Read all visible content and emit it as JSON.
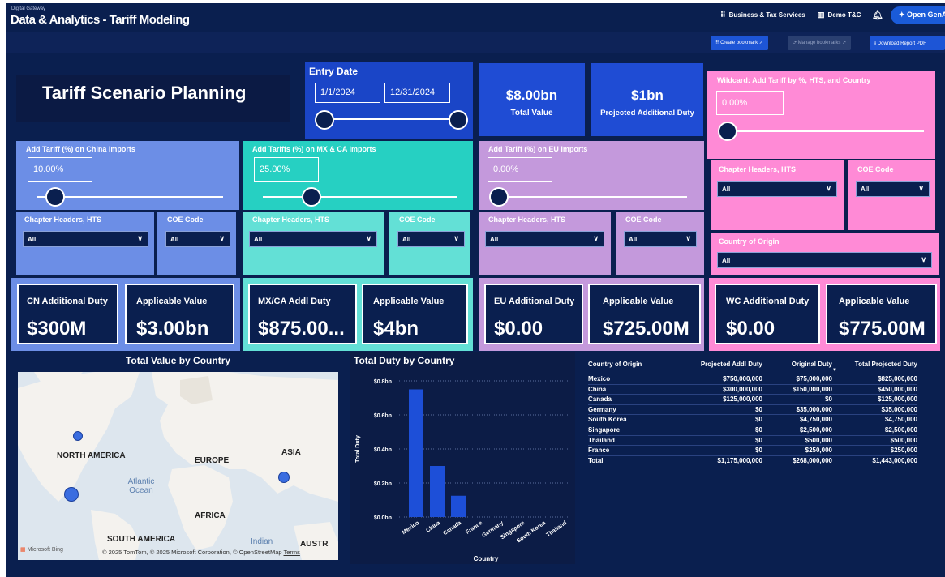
{
  "header": {
    "brand_small": "Digital Gateway",
    "title": "Data & Analytics - Tariff Modeling",
    "nav": [
      {
        "icon": "grid-icon",
        "label": "Business & Tax Services"
      },
      {
        "icon": "workspace-icon",
        "label": "Demo T&C"
      }
    ],
    "genai_label": "Open GenAI"
  },
  "toolbar": {
    "create_bookmark": "Create bookmark",
    "manage_bookmarks": "Manage bookmarks",
    "download_pdf": "Download Report PDF"
  },
  "page_title": "Tariff Scenario Planning",
  "entry_date": {
    "label": "Entry Date",
    "start": "1/1/2024",
    "end": "12/31/2024",
    "range_fraction": [
      0,
      1
    ]
  },
  "totals": {
    "total_value": "$8.00bn",
    "total_value_label": "Total Value",
    "projected_duty": "$1bn",
    "projected_duty_label": "Projected Additional Duty"
  },
  "colors": {
    "china": "#6c8ee6",
    "mxca": "#26d0c2",
    "eu": "#c499dc",
    "wildcard": "#ff8ad6",
    "bar": "#1d4fd8",
    "background": "#0a1f4f"
  },
  "china_panel": {
    "tariff_label": "Add Tariff (%) on China Imports",
    "tariff_value": "10.00%",
    "slider_fraction": 0.1,
    "chapter_label": "Chapter Headers, HTS",
    "chapter_value": "All",
    "coe_label": "COE Code",
    "coe_value": "All",
    "kpi_duty_label": "CN Additional Duty",
    "kpi_duty_value": "$300M",
    "kpi_value_label": "Applicable Value",
    "kpi_value_value": "$3.00bn"
  },
  "mxca_panel": {
    "tariff_label": "Add Tariffs (%) on MX & CA Imports",
    "tariff_value": "25.00%",
    "slider_fraction": 0.25,
    "chapter_label": "Chapter Headers, HTS",
    "chapter_value": "All",
    "coe_label": "COE Code",
    "coe_value": "All",
    "kpi_duty_label": "MX/CA Addl Duty",
    "kpi_duty_value": "$875.00...",
    "kpi_value_label": "Applicable Value",
    "kpi_value_value": "$4bn"
  },
  "eu_panel": {
    "tariff_label": "Add Tariff (%) on EU Imports",
    "tariff_value": "0.00%",
    "slider_fraction": 0,
    "chapter_label": "Chapter Headers, HTS",
    "chapter_value": "All",
    "coe_label": "COE Code",
    "coe_value": "All",
    "kpi_duty_label": "EU Additional Duty",
    "kpi_duty_value": "$0.00",
    "kpi_value_label": "Applicable Value",
    "kpi_value_value": "$725.00M"
  },
  "wildcard_panel": {
    "tariff_label": "Wildcard: Add Tariff by %, HTS, and Country",
    "tariff_value": "0.00%",
    "slider_fraction": 0,
    "chapter_label": "Chapter Headers, HTS",
    "chapter_value": "All",
    "coe_label": "COE Code",
    "coe_value": "All",
    "country_label": "Country of Origin",
    "country_value": "All",
    "kpi_duty_label": "WC Additional Duty",
    "kpi_duty_value": "$0.00",
    "kpi_value_label": "Applicable Value",
    "kpi_value_value": "$775.00M"
  },
  "map": {
    "title": "Total Value by Country",
    "labels": [
      "NORTH AMERICA",
      "EUROPE",
      "ASIA",
      "AFRICA",
      "SOUTH AMERICA",
      "AUSTR"
    ],
    "ocean_atlantic": "Atlantic\nOcean",
    "ocean_indian": "Indian",
    "bing": "Microsoft Bing",
    "attribution": "© 2025 TomTom, © 2025 Microsoft Corporation, © OpenStreetMap",
    "terms": "Terms"
  },
  "chart_data": {
    "type": "bar",
    "title": "Total Duty by Country",
    "xlabel": "Country",
    "ylabel": "Total Duty",
    "categories": [
      "Mexico",
      "China",
      "Canada",
      "France",
      "Germany",
      "Singapore",
      "South Korea",
      "Thailand"
    ],
    "values": [
      0.75,
      0.3,
      0.125,
      0,
      0,
      0,
      0,
      0
    ],
    "unit": "bn",
    "yticks": [
      "$0.0bn",
      "$0.2bn",
      "$0.4bn",
      "$0.6bn",
      "$0.8bn"
    ],
    "ylim": [
      0,
      0.8
    ],
    "grid": true
  },
  "table": {
    "columns": [
      "Country of Origin",
      "Projected Addl Duty",
      "Original Duty",
      "Total Projected Duty"
    ],
    "rows": [
      [
        "Mexico",
        "$750,000,000",
        "$75,000,000",
        "$825,000,000"
      ],
      [
        "China",
        "$300,000,000",
        "$150,000,000",
        "$450,000,000"
      ],
      [
        "Canada",
        "$125,000,000",
        "$0",
        "$125,000,000"
      ],
      [
        "Germany",
        "$0",
        "$35,000,000",
        "$35,000,000"
      ],
      [
        "South Korea",
        "$0",
        "$4,750,000",
        "$4,750,000"
      ],
      [
        "Singapore",
        "$0",
        "$2,500,000",
        "$2,500,000"
      ],
      [
        "Thailand",
        "$0",
        "$500,000",
        "$500,000"
      ],
      [
        "France",
        "$0",
        "$250,000",
        "$250,000"
      ]
    ],
    "total": [
      "Total",
      "$1,175,000,000",
      "$268,000,000",
      "$1,443,000,000"
    ]
  }
}
